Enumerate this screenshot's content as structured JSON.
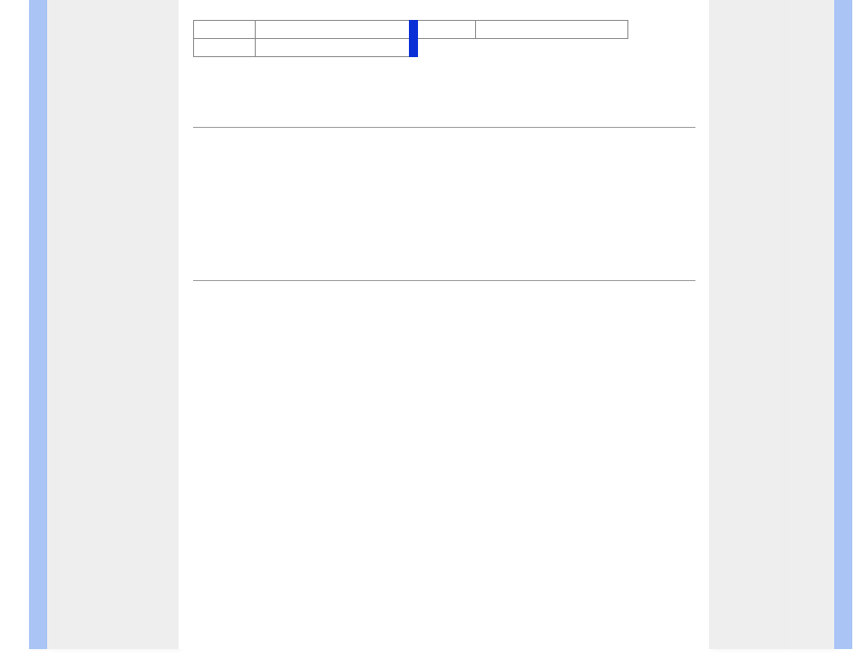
{
  "table": {
    "row1": {
      "a": "",
      "b": "",
      "c": "",
      "d": ""
    },
    "row2": {
      "a": "",
      "b": ""
    }
  },
  "colors": {
    "blue_bar": "#a9c4f5",
    "blue_chip": "#0a2fd6",
    "grey_panel": "#eeeeee",
    "divider": "#9a9a9a"
  }
}
